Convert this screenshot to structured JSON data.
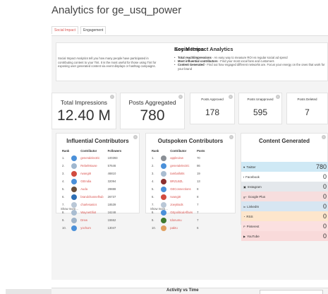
{
  "page": {
    "title": "Analytics for ge_usq_power"
  },
  "tabs": [
    {
      "label": "Social Impact"
    },
    {
      "label": "Engagement"
    }
  ],
  "intro": {
    "heading": "Social Impact Analytics",
    "text": "Social Impact Analytics tell you how many people have participated in contributing content to your Tint. It is the most useful for those using Tint for exposing user generated content via event displays or hashtag campaigns."
  },
  "key_metrics": {
    "heading": "Key Metrics",
    "items": [
      {
        "bold": "Total reach/impressions",
        "text": " - An easy way to measure ROI vs regular social ad spend"
      },
      {
        "bold": "Most influential contributors",
        "text": " - Find your most vocal fans and customers"
      },
      {
        "bold": "Content Generated",
        "text": " - Find out how engaged different networks are. Focus your energy on the ones that work for your brand"
      }
    ]
  },
  "stats": {
    "impressions": {
      "label": "Total Impressions",
      "value": "12.40 M"
    },
    "aggregated": {
      "label": "Posts Aggregated",
      "value": "780"
    },
    "approved": {
      "label": "Posts Approved",
      "value": "178"
    },
    "unapproved": {
      "label": "Posts Unapproved",
      "value": "595"
    },
    "deleted": {
      "label": "Posts Deleted",
      "value": "7"
    }
  },
  "influential": {
    "title": "Influential Contributors",
    "headers": [
      "Rank",
      "Contributor",
      "Followers"
    ],
    "rows": [
      {
        "rank": "1.",
        "name": "generalelectric",
        "count": "100393"
      },
      {
        "rank": "2.",
        "name": "RebelMouse",
        "count": "57646"
      },
      {
        "rank": "3.",
        "name": "rwangi8",
        "count": "46810"
      },
      {
        "rank": "4.",
        "name": "GEIndia",
        "count": "32094"
      },
      {
        "rank": "5.",
        "name": "Auda",
        "count": "29888"
      },
      {
        "rank": "6.",
        "name": "brandchannelhub",
        "count": "26737"
      },
      {
        "rank": "7.",
        "name": "charlesasics",
        "count": "18539"
      },
      {
        "rank": "8.",
        "name": "WayneElliot",
        "count": "16248"
      },
      {
        "rank": "9.",
        "name": "Drew",
        "count": "15552"
      },
      {
        "rank": "10.",
        "name": "yochum",
        "count": "13047"
      }
    ],
    "more": "Show more..."
  },
  "outspoken": {
    "title": "Outspoken Contributors",
    "headers": [
      "Rank",
      "Contributor",
      "Posts"
    ],
    "rows": [
      {
        "rank": "1.",
        "name": "appleview",
        "count": "70"
      },
      {
        "rank": "2.",
        "name": "generalelectric",
        "count": "86"
      },
      {
        "rank": "3.",
        "name": "tamballotts",
        "count": "19"
      },
      {
        "rank": "4.",
        "name": "BRZLBZL",
        "count": "13"
      },
      {
        "rank": "5.",
        "name": "GEConnections",
        "count": "8"
      },
      {
        "rank": "6.",
        "name": "rwangi8",
        "count": "8"
      },
      {
        "rank": "7.",
        "name": "JoeyBods",
        "count": "7"
      },
      {
        "rank": "8.",
        "name": "GEpoliticalAffairs",
        "count": "7"
      },
      {
        "rank": "9.",
        "name": "tdonumu",
        "count": "7"
      },
      {
        "rank": "10.",
        "name": "pakru",
        "count": "6"
      }
    ],
    "more": "Show more..."
  },
  "content_generated": {
    "title": "Content Generated",
    "rows": [
      {
        "network": "Twitter",
        "value": "780",
        "color": "#cfe9f5"
      },
      {
        "network": "Facebook",
        "value": "0",
        "color": "#ffffff"
      },
      {
        "network": "Instagram",
        "value": "0",
        "color": "#e4e8ec"
      },
      {
        "network": "Google Plus",
        "value": "0",
        "color": "#f7dede"
      },
      {
        "network": "LinkedIn",
        "value": "0",
        "color": "#d7e6f2"
      },
      {
        "network": "RSS",
        "value": "0",
        "color": "#fde6cc"
      },
      {
        "network": "Pinterest",
        "value": "0",
        "color": "#fbe0e0"
      },
      {
        "network": "YouTube",
        "value": "0",
        "color": "#f9dada"
      }
    ]
  },
  "activity": {
    "title": "Activity vs Time"
  }
}
